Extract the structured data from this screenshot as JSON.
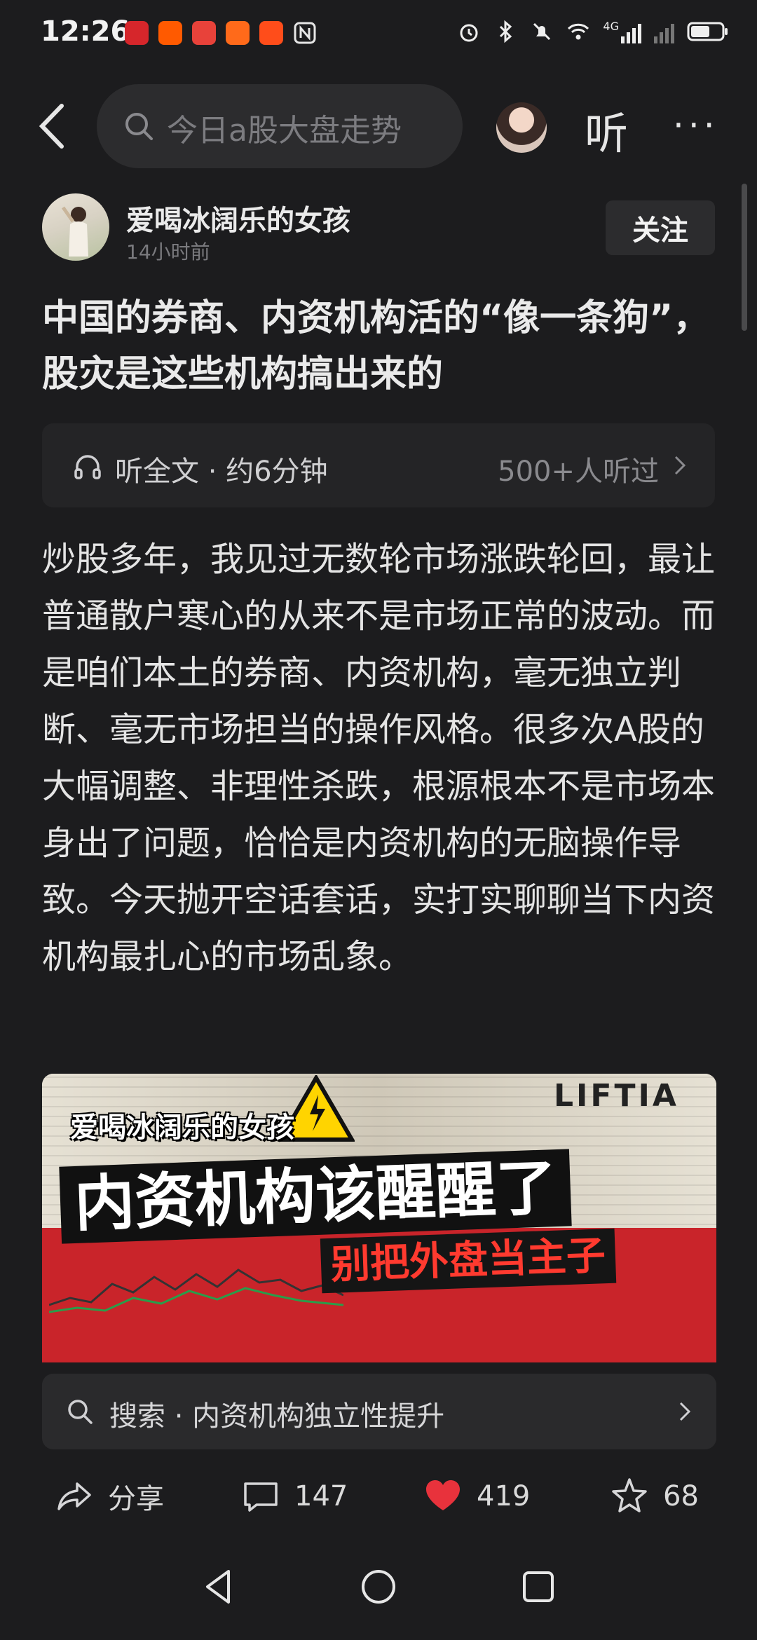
{
  "status_bar": {
    "time": "12:26",
    "network_label": "4G"
  },
  "top_nav": {
    "search_placeholder": "今日a股大盘走势",
    "listen_label": "听",
    "more_label": "···"
  },
  "author": {
    "name": "爱喝冰阔乐的女孩",
    "time": "14小时前",
    "follow_label": "关注"
  },
  "article": {
    "title": "中国的券商、内资机构活的“像一条狗”，股灾是这些机构搞出来的",
    "listen_label": "听全文 · 约6分钟",
    "listen_count": "500+人听过",
    "body": "炒股多年，我见过无数轮市场涨跌轮回，最让普通散户寒心的从来不是市场正常的波动。而是咱们本土的券商、内资机构，毫无独立判断、毫无市场担当的操作风格。很多次A股的大幅调整、非理性杀跌，根源根本不是市场本身出了问题，恰恰是内资机构的无脑操作导致。今天抛开空话套话，实打实聊聊当下内资机构最扎心的市场乱象。"
  },
  "poster": {
    "tag": "爱喝冰阔乐的女孩",
    "headline": "内资机构该醒醒了",
    "subheadline": "别把外盘当主子",
    "sign": "LIFTIA"
  },
  "search_suggest": {
    "text": "搜索 · 内资机构独立性提升"
  },
  "actions": {
    "share_label": "分享",
    "comments": "147",
    "likes": "419",
    "favorites": "68"
  },
  "colors": {
    "background": "#1c1c1e",
    "like_red": "#e8323c",
    "poster_red": "#c9242a"
  }
}
